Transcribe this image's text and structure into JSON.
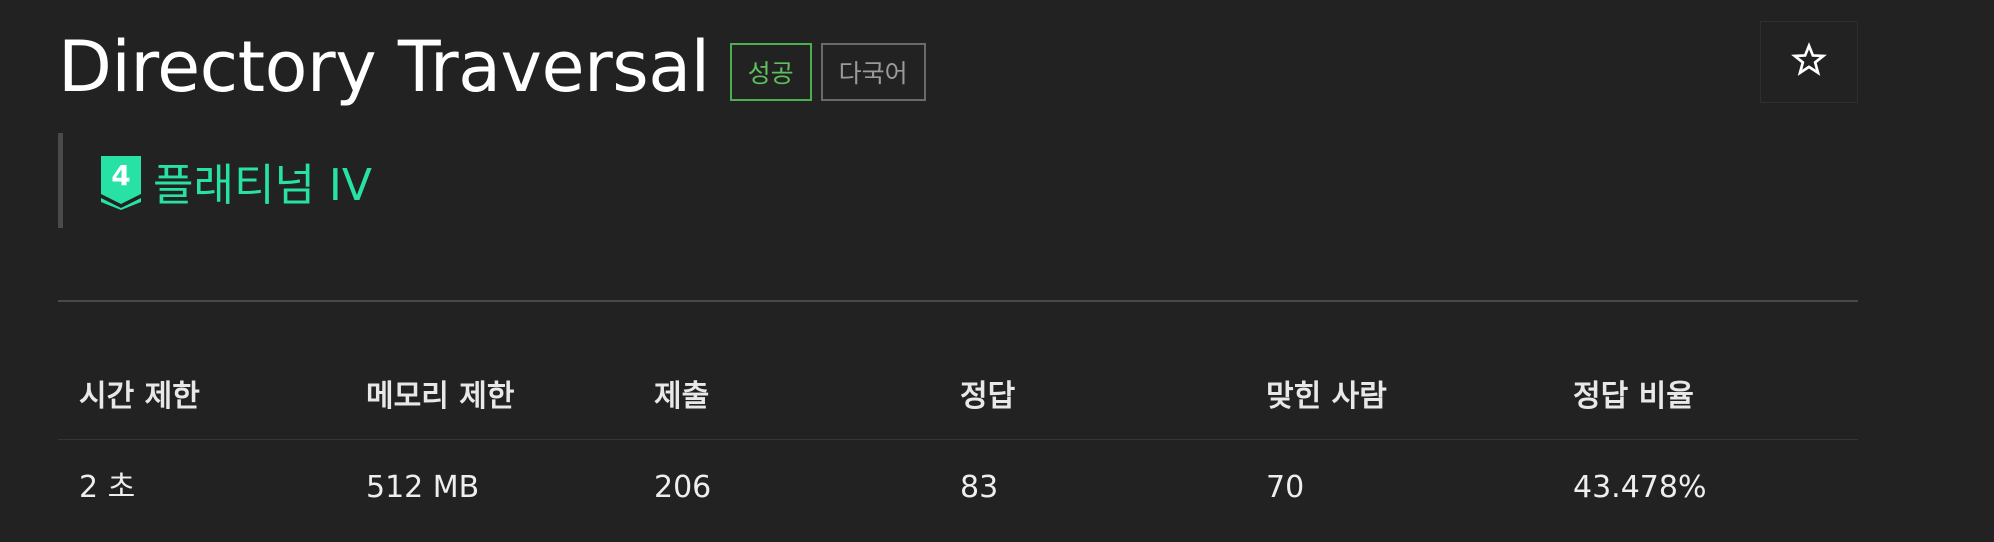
{
  "problem": {
    "title": "Directory Traversal",
    "badges": {
      "success": "성공",
      "multilang": "다국어"
    },
    "tier": {
      "level": "4",
      "label": "플래티넘 IV",
      "color": "#27e2a4"
    },
    "favorite_icon": "star-outline-icon"
  },
  "stats": {
    "headers": [
      "시간 제한",
      "메모리 제한",
      "제출",
      "정답",
      "맞힌 사람",
      "정답 비율"
    ],
    "values": [
      "2 초",
      "512 MB",
      "206",
      "83",
      "70",
      "43.478%"
    ]
  }
}
